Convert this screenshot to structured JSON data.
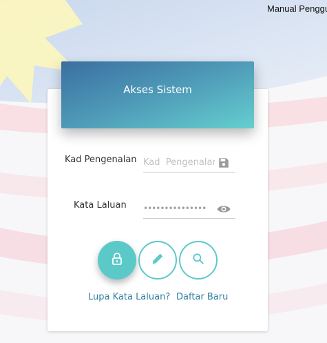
{
  "header": {
    "manual_link": "Manual Pengguna"
  },
  "login": {
    "title": "Akses Sistem",
    "id_label": "Kad Pengenalan",
    "id_placeholder": "Kad  Pengenalan",
    "password_label": "Kata Laluan",
    "password_value": "•••••••••••••••",
    "buttons": {
      "login_icon": "lock-icon",
      "register_icon": "pencil-icon",
      "search_icon": "search-icon"
    },
    "forgot_link": "Lupa Kata Laluan?",
    "register_link": "Daftar Baru"
  },
  "colors": {
    "accent": "#5cc9c9",
    "link": "#2f7e9e",
    "header_gradient_start": "#3a6fa0",
    "header_gradient_end": "#64cfcf"
  }
}
